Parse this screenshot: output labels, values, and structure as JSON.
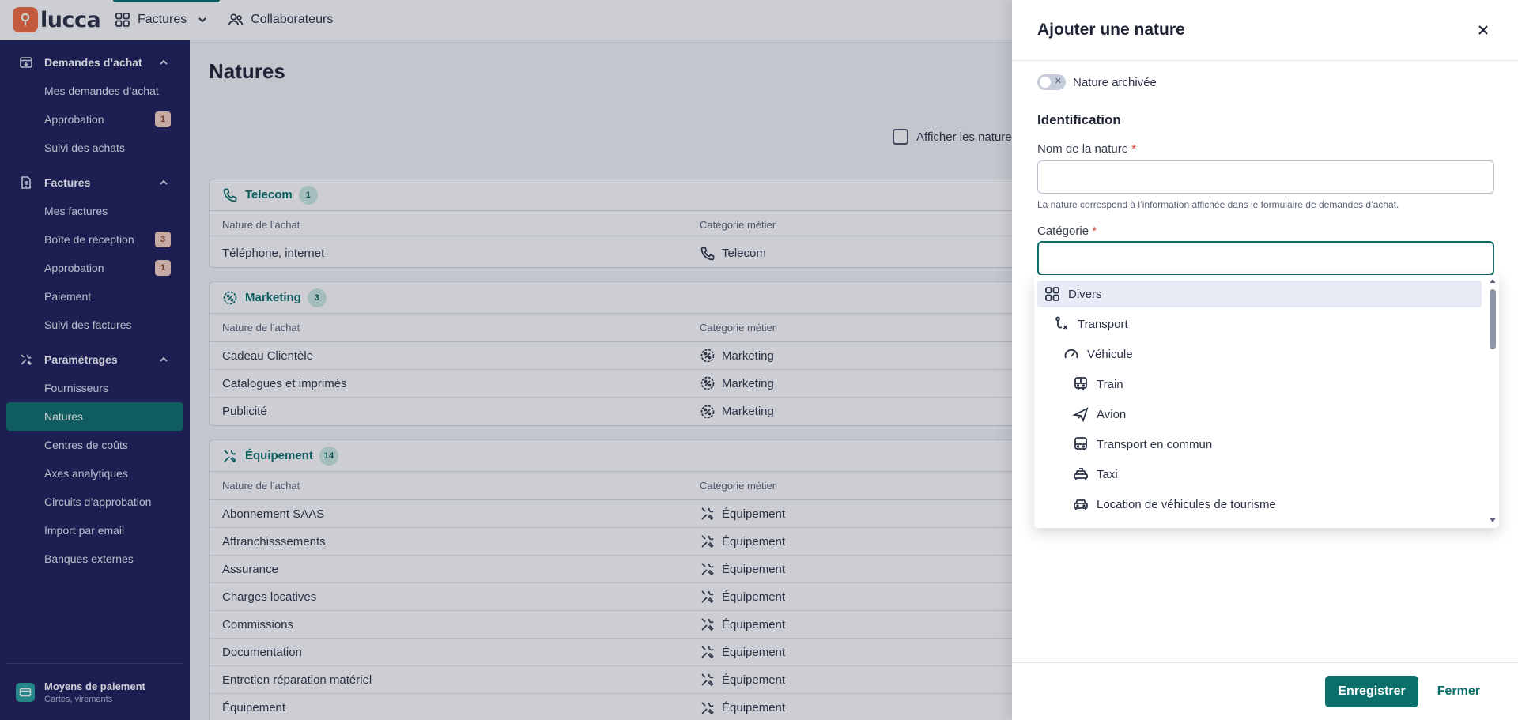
{
  "app": {
    "logo_text": "lucca",
    "brand_color": "#f36b3e",
    "accent_color": "#0c6f69"
  },
  "topnav": [
    {
      "label": "Factures",
      "icon": "grid-icon",
      "active": true
    },
    {
      "label": "Collaborateurs",
      "icon": "users-icon",
      "active": false
    }
  ],
  "sidebar": {
    "sections": [
      {
        "title": "Demandes d’achat",
        "icon": "purchase-box-icon",
        "items": [
          {
            "label": "Mes demandes d’achat",
            "badge": ""
          },
          {
            "label": "Approbation",
            "badge": "1"
          },
          {
            "label": "Suivi des achats",
            "badge": ""
          }
        ]
      },
      {
        "title": "Factures",
        "icon": "invoice-icon",
        "items": [
          {
            "label": "Mes factures",
            "badge": ""
          },
          {
            "label": "Boîte de réception",
            "badge": "3"
          },
          {
            "label": "Approbation",
            "badge": "1"
          },
          {
            "label": "Paiement",
            "badge": ""
          },
          {
            "label": "Suivi des factures",
            "badge": ""
          }
        ]
      },
      {
        "title": "Paramétrages",
        "icon": "tools-icon",
        "items": [
          {
            "label": "Fournisseurs",
            "badge": ""
          },
          {
            "label": "Natures",
            "badge": "",
            "active": true
          },
          {
            "label": "Centres de coûts",
            "badge": ""
          },
          {
            "label": "Axes analytiques",
            "badge": ""
          },
          {
            "label": "Circuits d’approbation",
            "badge": ""
          },
          {
            "label": "Import par email",
            "badge": ""
          },
          {
            "label": "Banques externes",
            "badge": ""
          }
        ]
      }
    ],
    "footer": {
      "title": "Moyens de paiement",
      "subtitle": "Cartes, virements"
    }
  },
  "main": {
    "title": "Natures",
    "archived_filter_label": "Afficher les natures",
    "col_nature": "Nature de l’achat",
    "col_categorie": "Catégorie métier",
    "groups": [
      {
        "title": "Telecom",
        "count": "1",
        "icon": "phone-icon",
        "rows": [
          {
            "nature": "Téléphone, internet",
            "categorie": "Telecom"
          }
        ]
      },
      {
        "title": "Marketing",
        "count": "3",
        "icon": "marketing-icon",
        "rows": [
          {
            "nature": "Cadeau Clientèle",
            "categorie": "Marketing"
          },
          {
            "nature": "Catalogues et imprimés",
            "categorie": "Marketing"
          },
          {
            "nature": "Publicité",
            "categorie": "Marketing"
          }
        ]
      },
      {
        "title": "Équipement",
        "count": "14",
        "icon": "equipment-icon",
        "rows": [
          {
            "nature": "Abonnement SAAS",
            "categorie": "Équipement"
          },
          {
            "nature": "Affranchisssements",
            "categorie": "Équipement"
          },
          {
            "nature": "Assurance",
            "categorie": "Équipement"
          },
          {
            "nature": "Charges locatives",
            "categorie": "Équipement"
          },
          {
            "nature": "Commissions",
            "categorie": "Équipement"
          },
          {
            "nature": "Documentation",
            "categorie": "Équipement"
          },
          {
            "nature": "Entretien réparation matériel",
            "categorie": "Équipement"
          },
          {
            "nature": "Équipement",
            "categorie": "Équipement"
          }
        ]
      }
    ]
  },
  "panel": {
    "title": "Ajouter une nature",
    "archived_toggle_label": "Nature archivée",
    "section_title": "Identification",
    "name_label": "Nom de la nature",
    "required_mark": "*",
    "name_value": "",
    "hint": "La nature correspond à l’information affichée dans le formulaire de demandes d’achat.",
    "category_label": "Catégorie",
    "category_value": "",
    "dropdown_options": [
      {
        "label": "Divers",
        "icon": "grid-icon",
        "level": 0,
        "highlighted": true
      },
      {
        "label": "Transport",
        "icon": "route-icon",
        "level": 1
      },
      {
        "label": "Véhicule",
        "icon": "gauge-icon",
        "level": 2
      },
      {
        "label": "Train",
        "icon": "train-icon",
        "level": 3
      },
      {
        "label": "Avion",
        "icon": "plane-icon",
        "level": 3
      },
      {
        "label": "Transport en commun",
        "icon": "bus-icon",
        "level": 3
      },
      {
        "label": "Taxi",
        "icon": "taxi-icon",
        "level": 3
      },
      {
        "label": "Location de véhicules de tourisme",
        "icon": "car-icon",
        "level": 3
      }
    ],
    "save_label": "Enregistrer",
    "close_label": "Fermer"
  }
}
